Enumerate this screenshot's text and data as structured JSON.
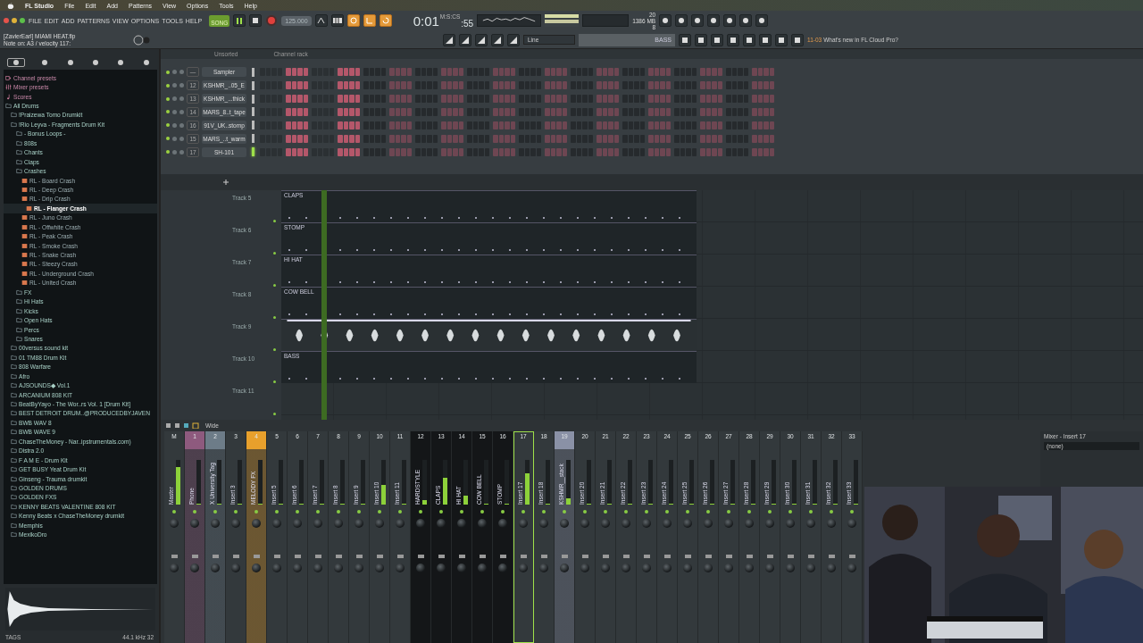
{
  "menubar": {
    "app": "FL Studio",
    "items": [
      "File",
      "Edit",
      "Add",
      "Patterns",
      "View",
      "Options",
      "Tools",
      "Help"
    ]
  },
  "toolbar": {
    "menus": [
      "FILE",
      "EDIT",
      "ADD",
      "PATTERNS",
      "VIEW",
      "OPTIONS",
      "TOOLS",
      "HELP"
    ],
    "mode": "SONG",
    "tempo": "125.000",
    "time": "0:01",
    "time_small": ":55",
    "time_unit": "M:S:CS",
    "cpu_num": "20",
    "memory": "1386 MB",
    "polyphony": "8",
    "project": "[ZavierEarl] MIAMI HEAT.flp",
    "hint": "Note on: A3 / velocity 117:",
    "snap": "Line",
    "pattern": "BASS",
    "news_date": "11-03",
    "news": "What's new in FL Cloud Pro?",
    "recording": true
  },
  "browser": {
    "tabs": [
      {
        "selected": true
      },
      {
        "selected": false
      },
      {
        "selected": false
      },
      {
        "selected": false
      },
      {
        "selected": false
      },
      {
        "selected": false
      }
    ],
    "items": [
      {
        "label": "Channel presets",
        "kind": "preset"
      },
      {
        "label": "Mixer presets",
        "kind": "mixer"
      },
      {
        "label": "Scores",
        "kind": "score"
      },
      {
        "label": "All Drums",
        "kind": "folder",
        "children": [
          {
            "label": "!Praizewa Tomo Drumkit",
            "kind": "folder"
          },
          {
            "label": "!Rio Leyva - Fragments Drum Kit",
            "kind": "folder",
            "children": [
              {
                "label": "- Bonus Loops -",
                "kind": "folder"
              },
              {
                "label": "808s",
                "kind": "folder"
              },
              {
                "label": "Chants",
                "kind": "folder"
              },
              {
                "label": "Claps",
                "kind": "folder"
              },
              {
                "label": "Crashes",
                "kind": "folder",
                "children": [
                  {
                    "label": "RL - Board Crash",
                    "kind": "file",
                    "selected": false
                  },
                  {
                    "label": "RL - Deep Crash",
                    "kind": "file",
                    "selected": false
                  },
                  {
                    "label": "RL - Drip Crash",
                    "kind": "file",
                    "selected": false
                  },
                  {
                    "label": "RL - Flanger Crash",
                    "kind": "file",
                    "selected": true
                  },
                  {
                    "label": "RL - Juno Crash",
                    "kind": "file",
                    "selected": false
                  },
                  {
                    "label": "RL - Offwhite Crash",
                    "kind": "file",
                    "selected": false
                  },
                  {
                    "label": "RL - Peak Crash",
                    "kind": "file",
                    "selected": false
                  },
                  {
                    "label": "RL - Smoke Crash",
                    "kind": "file",
                    "selected": false
                  },
                  {
                    "label": "RL - Snake Crash",
                    "kind": "file",
                    "selected": false
                  },
                  {
                    "label": "RL - Steezy Crash",
                    "kind": "file",
                    "selected": false
                  },
                  {
                    "label": "RL - Underground Crash",
                    "kind": "file",
                    "selected": false
                  },
                  {
                    "label": "RL - United Crash",
                    "kind": "file",
                    "selected": false
                  }
                ]
              },
              {
                "label": "FX",
                "kind": "folder"
              },
              {
                "label": "Hi Hats",
                "kind": "folder"
              },
              {
                "label": "Kicks",
                "kind": "folder"
              },
              {
                "label": "Open Hats",
                "kind": "folder"
              },
              {
                "label": "Percs",
                "kind": "folder"
              },
              {
                "label": "Snares",
                "kind": "folder"
              }
            ]
          },
          {
            "label": "00versus sound kit",
            "kind": "folder"
          },
          {
            "label": "01 TM88 Drum Kit",
            "kind": "folder"
          },
          {
            "label": "808 Warfare",
            "kind": "folder"
          },
          {
            "label": "Afro",
            "kind": "folder"
          },
          {
            "label": "AJSOUNDS◆ Vol.1",
            "kind": "folder"
          },
          {
            "label": "ARCANIUM 808 KIT",
            "kind": "folder"
          },
          {
            "label": "BeatByYayo - The Wor..rs Vol. 1 [Drum Kit]",
            "kind": "folder"
          },
          {
            "label": "BEST DETROIT DRUM..@PRODUCEDBYJAVEN",
            "kind": "folder"
          },
          {
            "label": "BWB WAV 8",
            "kind": "folder"
          },
          {
            "label": "BWB WAVE 9",
            "kind": "folder"
          },
          {
            "label": "ChaseTheMoney - Nar..ipstrumentals.com)",
            "kind": "folder"
          },
          {
            "label": "Distra 2.0",
            "kind": "folder"
          },
          {
            "label": "F A M E - Drum Kit",
            "kind": "folder"
          },
          {
            "label": "GET BUSY Yeat Drum Kit",
            "kind": "folder"
          },
          {
            "label": "Ginseng - Trauma drumkit",
            "kind": "folder"
          },
          {
            "label": "GOLDEN DRUMS",
            "kind": "folder"
          },
          {
            "label": "GOLDEN FXS",
            "kind": "folder"
          },
          {
            "label": "KENNY BEATS VALENTINE 808 KIT",
            "kind": "folder"
          },
          {
            "label": "Kenny Beats x ChaseTheMoney drumkit",
            "kind": "folder"
          },
          {
            "label": "Memphis",
            "kind": "folder"
          },
          {
            "label": "MexikoDro",
            "kind": "folder"
          }
        ]
      }
    ],
    "sample_rate": "44.1 kHz 32",
    "tags": "TAGS"
  },
  "channel_rack": {
    "filter": "Unsorted",
    "title": "Channel rack",
    "channels": [
      {
        "number": "—",
        "name": "Sampler",
        "selected": false,
        "steps": [
          false,
          false,
          false,
          false,
          true,
          true,
          true,
          true,
          false,
          false,
          false,
          false,
          true,
          true,
          true,
          true
        ]
      },
      {
        "number": "12",
        "name": "KSHMR_..05_E",
        "selected": false,
        "steps": [
          false,
          false,
          false,
          false,
          true,
          true,
          true,
          true,
          false,
          false,
          false,
          false,
          true,
          true,
          true,
          true
        ]
      },
      {
        "number": "13",
        "name": "KSHMR_...thick",
        "selected": false,
        "steps": [
          false,
          false,
          false,
          false,
          true,
          true,
          true,
          true,
          false,
          false,
          false,
          false,
          true,
          true,
          true,
          true
        ]
      },
      {
        "number": "14",
        "name": "MARS_8..t_tape",
        "selected": false,
        "steps": [
          false,
          false,
          false,
          false,
          true,
          true,
          true,
          true,
          false,
          false,
          false,
          false,
          true,
          true,
          true,
          true
        ]
      },
      {
        "number": "16",
        "name": "91V_UK..stomp",
        "selected": false,
        "steps": [
          false,
          false,
          false,
          false,
          true,
          true,
          true,
          true,
          false,
          false,
          false,
          false,
          true,
          true,
          true,
          true
        ]
      },
      {
        "number": "15",
        "name": "MARS_..t_warm",
        "selected": false,
        "steps": [
          false,
          false,
          false,
          false,
          true,
          true,
          true,
          true,
          false,
          false,
          false,
          false,
          true,
          true,
          true,
          true
        ]
      },
      {
        "number": "17",
        "name": "SH-101",
        "selected": true,
        "steps": [
          false,
          false,
          false,
          false,
          true,
          true,
          true,
          true,
          false,
          false,
          false,
          false,
          true,
          true,
          true,
          true
        ]
      }
    ]
  },
  "playlist": {
    "tracks": [
      {
        "name": "Track 5",
        "clip": {
          "kind": "pattern",
          "label": "CLAPS"
        }
      },
      {
        "name": "Track 6",
        "clip": {
          "kind": "pattern",
          "label": "STOMP"
        }
      },
      {
        "name": "Track 7",
        "clip": {
          "kind": "pattern",
          "label": "HI HAT"
        }
      },
      {
        "name": "Track 8",
        "clip": {
          "kind": "pattern",
          "label": "COW BELL"
        }
      },
      {
        "name": "Track 9",
        "clip": {
          "kind": "audio"
        }
      },
      {
        "name": "Track 10",
        "clip": {
          "kind": "pattern",
          "label": "BASS"
        }
      },
      {
        "name": "Track 11"
      }
    ]
  },
  "mixer": {
    "view": "Wide",
    "title": "Mixer - Insert 17",
    "routing": "(none)",
    "strips": [
      {
        "number": "M",
        "name": "Master",
        "kind": "master",
        "selected": false,
        "level": 0.85
      },
      {
        "number": "1",
        "name": "Phone",
        "kind": "insert",
        "color": "#8e5a7e",
        "selected": false,
        "level": 0
      },
      {
        "number": "2",
        "name": "X University Tag",
        "kind": "insert",
        "color": "#6d7c88",
        "selected": false,
        "level": 0
      },
      {
        "number": "3",
        "name": "Insert 3",
        "kind": "insert",
        "selected": false,
        "level": 0
      },
      {
        "number": "4",
        "name": "MELODY FX",
        "kind": "insert",
        "color": "#e8a02c",
        "selected": false,
        "level": 0
      },
      {
        "number": "5",
        "name": "Insert 5",
        "kind": "insert",
        "selected": false,
        "level": 0
      },
      {
        "number": "6",
        "name": "Insert 6",
        "kind": "insert",
        "selected": false,
        "level": 0
      },
      {
        "number": "7",
        "name": "Insert 7",
        "kind": "insert",
        "selected": false,
        "level": 0
      },
      {
        "number": "8",
        "name": "Insert 8",
        "kind": "insert",
        "selected": false,
        "level": 0
      },
      {
        "number": "9",
        "name": "Insert 9",
        "kind": "insert",
        "selected": false,
        "level": 0
      },
      {
        "number": "10",
        "name": "Insert 10",
        "kind": "insert",
        "selected": false,
        "level": 0.45
      },
      {
        "number": "11",
        "name": "Insert 11",
        "kind": "insert",
        "selected": false,
        "level": 0
      },
      {
        "number": "12",
        "name": "HARDSTYLE",
        "kind": "grouped",
        "selected": false,
        "level": 0.1
      },
      {
        "number": "13",
        "name": "CLAPS",
        "kind": "grouped",
        "selected": false,
        "level": 0.6
      },
      {
        "number": "14",
        "name": "HI HAT",
        "kind": "grouped",
        "selected": false,
        "level": 0.2
      },
      {
        "number": "15",
        "name": "COW BELL",
        "kind": "grouped",
        "selected": false,
        "level": 0
      },
      {
        "number": "16",
        "name": "STOMP",
        "kind": "grouped",
        "selected": false,
        "level": 0
      },
      {
        "number": "17",
        "name": "Insert 17",
        "kind": "insert",
        "selected": true,
        "level": 0.7
      },
      {
        "number": "18",
        "name": "Insert 18",
        "kind": "insert",
        "selected": false,
        "level": 0
      },
      {
        "number": "19",
        "name": "KSHMR__stack",
        "kind": "insert",
        "color": "#8a91a6",
        "selected": false,
        "level": 0.15
      },
      {
        "number": "20",
        "name": "Insert 20",
        "kind": "insert",
        "selected": false,
        "level": 0
      },
      {
        "number": "21",
        "name": "Insert 21",
        "kind": "insert",
        "selected": false,
        "level": 0
      },
      {
        "number": "22",
        "name": "Insert 22",
        "kind": "insert",
        "selected": false,
        "level": 0
      },
      {
        "number": "23",
        "name": "Insert 23",
        "kind": "insert",
        "selected": false,
        "level": 0
      },
      {
        "number": "24",
        "name": "Insert 24",
        "kind": "insert",
        "selected": false,
        "level": 0
      },
      {
        "number": "25",
        "name": "Insert 25",
        "kind": "insert",
        "selected": false,
        "level": 0
      },
      {
        "number": "26",
        "name": "Insert 26",
        "kind": "insert",
        "selected": false,
        "level": 0
      },
      {
        "number": "27",
        "name": "Insert 27",
        "kind": "insert",
        "selected": false,
        "level": 0
      },
      {
        "number": "28",
        "name": "Insert 28",
        "kind": "insert",
        "selected": false,
        "level": 0
      },
      {
        "number": "29",
        "name": "Insert 29",
        "kind": "insert",
        "selected": false,
        "level": 0
      },
      {
        "number": "30",
        "name": "Insert 30",
        "kind": "insert",
        "selected": false,
        "level": 0
      },
      {
        "number": "31",
        "name": "Insert 31",
        "kind": "insert",
        "selected": false,
        "level": 0
      },
      {
        "number": "32",
        "name": "Insert 32",
        "kind": "insert",
        "selected": false,
        "level": 0
      },
      {
        "number": "33",
        "name": "Insert 33",
        "kind": "insert",
        "selected": false,
        "level": 0
      }
    ]
  }
}
